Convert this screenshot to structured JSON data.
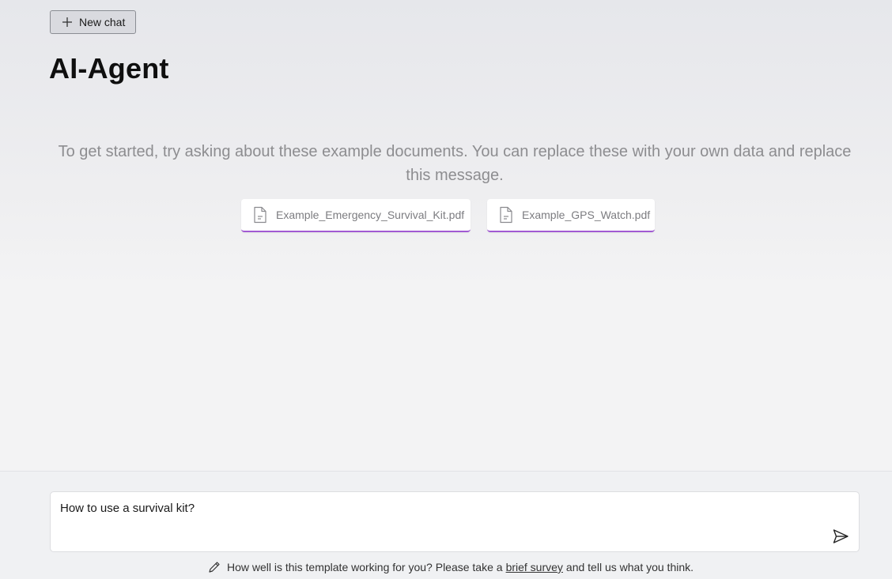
{
  "header": {
    "new_chat_label": "New chat",
    "title": "AI-Agent"
  },
  "intro": {
    "message": "To get started, try asking about these example documents. You can replace these with your own data and replace this message."
  },
  "documents": [
    {
      "name": "Example_Emergency_Survival_Kit.pdf",
      "icon": "document-icon"
    },
    {
      "name": "Example_GPS_Watch.pdf",
      "icon": "document-icon"
    }
  ],
  "chat_input": {
    "value": "How to use a survival kit?"
  },
  "footer": {
    "prefix": "How well is this template working for you? Please take a",
    "link_text": "brief survey",
    "suffix": "and tell us what you think."
  },
  "colors": {
    "accent": "#a15ad3"
  }
}
